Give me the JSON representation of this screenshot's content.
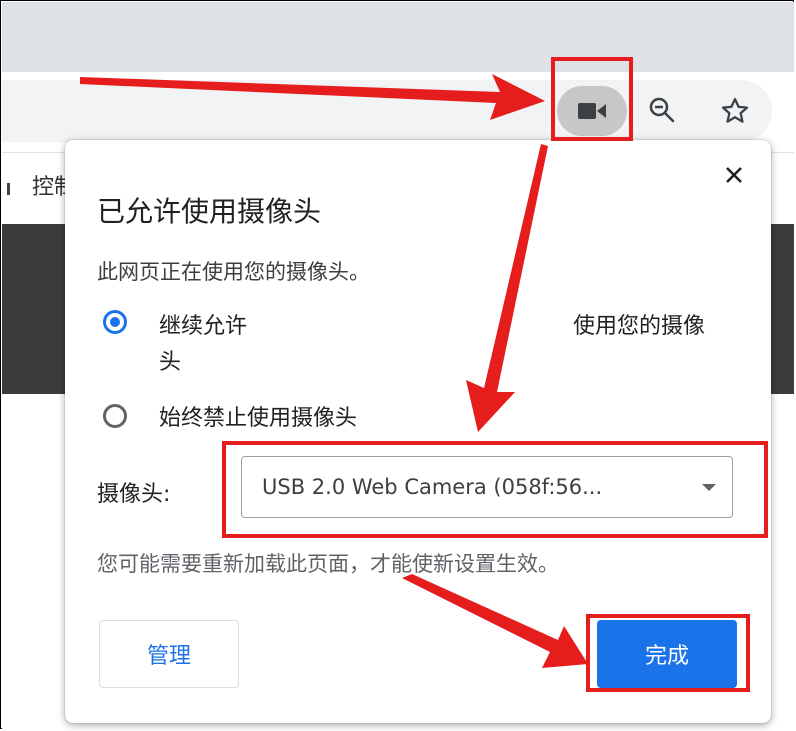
{
  "bookmark_bar": {
    "partial_text": "控制"
  },
  "popup": {
    "title": "已允许使用摄像头",
    "description": "此网页正在使用您的摄像头。",
    "option_allow_line1_start": "继续允许",
    "option_allow_line1_end": "使用您的摄像",
    "option_allow_line2": "头",
    "option_block": "始终禁止使用摄像头",
    "camera_label": "摄像头:",
    "camera_selected": "USB 2.0 Web Camera (058f:56...",
    "reload_note": "您可能需要重新加载此页面，才能使新设置生效。",
    "manage_label": "管理",
    "done_label": "完成",
    "allow_selected": true
  },
  "colors": {
    "accent": "#1a73e8",
    "annotation": "#e51d1d",
    "tabstrip": "#dee1e6",
    "dark_band": "#3c3c3c"
  },
  "icons": {
    "camera": "camera-icon",
    "zoom": "zoom-out-icon",
    "star": "star-icon",
    "close": "close-icon",
    "dropdown": "chevron-down-icon"
  }
}
